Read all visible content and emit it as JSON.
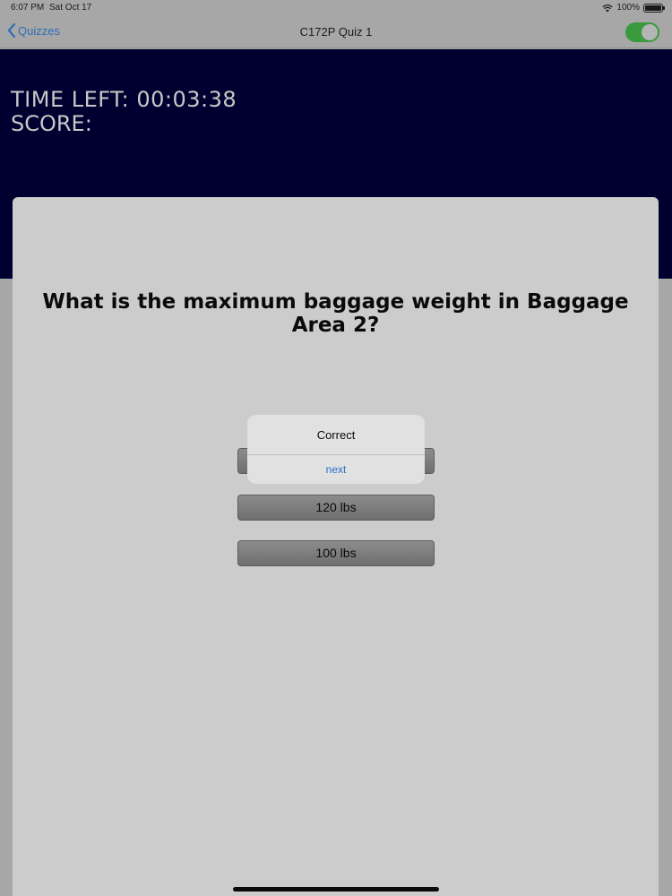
{
  "status_bar": {
    "time": "6:07 PM",
    "date": "Sat Oct 17",
    "battery": "100%"
  },
  "nav": {
    "back_label": "Quizzes",
    "title": "C172P Quiz 1",
    "toggle_on": true
  },
  "header": {
    "time_left": "TIME LEFT: 00:03:38",
    "score": "SCORE:"
  },
  "question": "What is the maximum baggage weight in Baggage Area 2?",
  "answers": [
    {
      "label": ""
    },
    {
      "label": "120 lbs"
    },
    {
      "label": "100 lbs"
    }
  ],
  "alert": {
    "title": "Correct",
    "action": "next"
  },
  "colors": {
    "header_bg": "#000030",
    "accent_blue": "#2f73c9",
    "toggle_green": "#3a9a3e"
  }
}
